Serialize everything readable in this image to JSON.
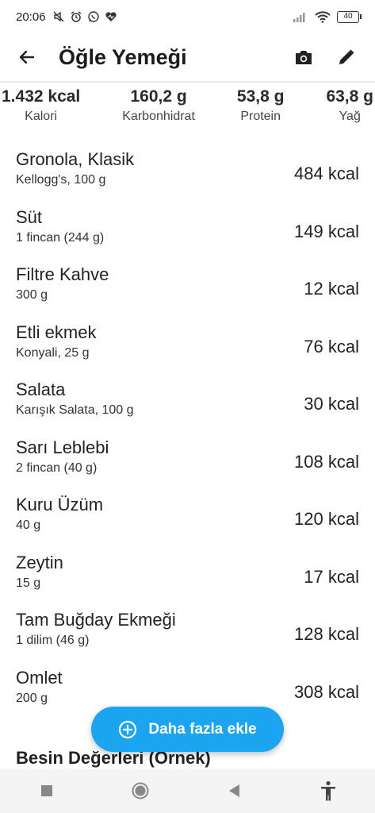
{
  "status": {
    "time": "20:06",
    "icons": [
      "mute-icon",
      "alarm-icon",
      "whatsapp-icon",
      "heart-icon"
    ],
    "battery": "40"
  },
  "appbar": {
    "title": "Öğle Yemeği",
    "back_icon": "arrow-back-icon",
    "camera_icon": "camera-icon",
    "edit_icon": "pencil-icon"
  },
  "summary": [
    {
      "value": "1.432 kcal",
      "label": "Kalori"
    },
    {
      "value": "160,2 g",
      "label": "Karbonhidrat"
    },
    {
      "value": "53,8 g",
      "label": "Protein"
    },
    {
      "value": "63,8 g",
      "label": "Yağ"
    }
  ],
  "foods": [
    {
      "name": "Gronola, Klasik",
      "detail": "Kellogg's, 100 g",
      "kcal": "484 kcal"
    },
    {
      "name": "Süt",
      "detail": "1 fincan (244 g)",
      "kcal": "149 kcal"
    },
    {
      "name": "Filtre Kahve",
      "detail": "300 g",
      "kcal": "12 kcal"
    },
    {
      "name": "Etli ekmek",
      "detail": "Konyali, 25 g",
      "kcal": "76 kcal"
    },
    {
      "name": "Salata",
      "detail": "Karışık Salata, 100 g",
      "kcal": "30 kcal"
    },
    {
      "name": "Sarı Leblebi",
      "detail": "2 fincan (40 g)",
      "kcal": "108 kcal"
    },
    {
      "name": "Kuru Üzüm",
      "detail": "40 g",
      "kcal": "120 kcal"
    },
    {
      "name": "Zeytin",
      "detail": "15 g",
      "kcal": "17 kcal"
    },
    {
      "name": "Tam Buğday Ekmeği",
      "detail": "1 dilim (46 g)",
      "kcal": "128 kcal"
    },
    {
      "name": "Omlet",
      "detail": "200 g",
      "kcal": "308 kcal"
    }
  ],
  "fab": {
    "label": "Daha fazla ekle",
    "icon": "plus-circle-icon",
    "color": "#1ba5f0"
  },
  "section_title": "Besin Değerleri (Örnek)",
  "navbar": [
    "square-icon",
    "circle-icon",
    "triangle-back-icon",
    "accessibility-icon"
  ]
}
